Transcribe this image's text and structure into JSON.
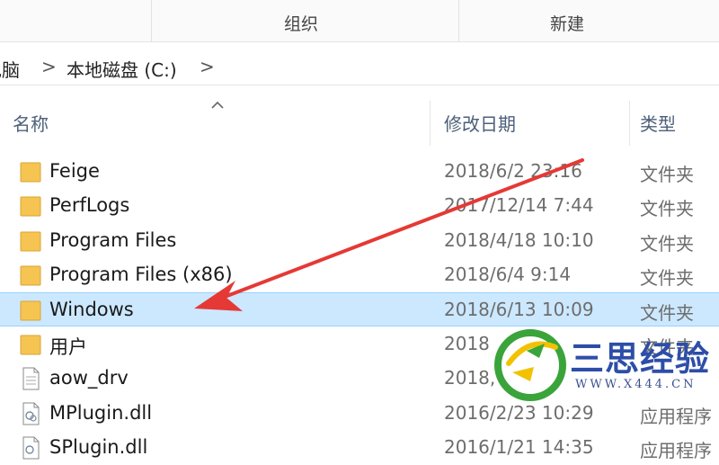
{
  "ribbon": {
    "organize_label": "组织",
    "new_label": "新建"
  },
  "address": {
    "crumbs": [
      "电脑",
      "本地磁盘 (C:)"
    ],
    "separator": ">"
  },
  "columns": {
    "name": "名称",
    "modified": "修改日期",
    "type": "类型"
  },
  "rows": [
    {
      "icon": "folder-icon",
      "name": "Feige",
      "date": "2018/6/2 23:16",
      "type": "文件夹"
    },
    {
      "icon": "folder-icon",
      "name": "PerfLogs",
      "date": "2017/12/14 7:44",
      "type": "文件夹"
    },
    {
      "icon": "folder-icon",
      "name": "Program Files",
      "date": "2018/4/18 10:10",
      "type": "文件夹"
    },
    {
      "icon": "folder-icon",
      "name": "Program Files (x86)",
      "date": "2018/6/4 9:14",
      "type": "文件夹"
    },
    {
      "icon": "folder-icon",
      "name": "Windows",
      "date": "2018/6/13 10:09",
      "type": "文件夹",
      "selected": true
    },
    {
      "icon": "folder-icon",
      "name": "用户",
      "date": "2018",
      "type": "文件夹"
    },
    {
      "icon": "file-icon",
      "name": "aow_drv",
      "date": "2018,",
      "type": ""
    },
    {
      "icon": "dll-icon",
      "name": "MPlugin.dll",
      "date": "2016/2/23 10:29",
      "type": "应用程序"
    },
    {
      "icon": "dll-icon",
      "name": "SPlugin.dll",
      "date": "2016/1/21 14:35",
      "type": "应用程序"
    }
  ],
  "watermark": {
    "text": "三思经验",
    "url": "WWW.X444.CN"
  },
  "colors": {
    "selection": "#cce8ff",
    "folder": "#f5c451",
    "arrow": "#e53935",
    "watermark_green": "#3aa43a",
    "watermark_blue": "#2d4ea8"
  }
}
